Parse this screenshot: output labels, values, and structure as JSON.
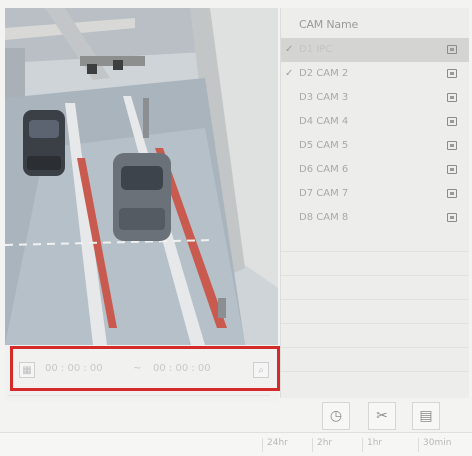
{
  "panel": {
    "header": "CAM Name",
    "cameras": [
      {
        "label": "D1 IPC",
        "checked": true,
        "selected": true
      },
      {
        "label": "D2 CAM 2",
        "checked": true,
        "selected": false
      },
      {
        "label": "D3 CAM 3",
        "checked": false,
        "selected": false
      },
      {
        "label": "D4 CAM 4",
        "checked": false,
        "selected": false
      },
      {
        "label": "D5 CAM 5",
        "checked": false,
        "selected": false
      },
      {
        "label": "D6 CAM 6",
        "checked": false,
        "selected": false
      },
      {
        "label": "D7 CAM 7",
        "checked": false,
        "selected": false
      },
      {
        "label": "D8 CAM 8",
        "checked": false,
        "selected": false
      }
    ]
  },
  "controls": {
    "start_time": "00 : 00 : 00",
    "end_time": "00 : 00 : 00"
  },
  "status_bar": [
    "24hr",
    "2hr",
    "1hr",
    "30min"
  ],
  "colors": {
    "highlight": "#d42a2a",
    "selected_row": "#d4d4d2",
    "panel_bg": "#ededec"
  },
  "icons": {
    "check": "✓",
    "tools": [
      "timer-icon",
      "scissors-icon",
      "grid-icon"
    ]
  }
}
